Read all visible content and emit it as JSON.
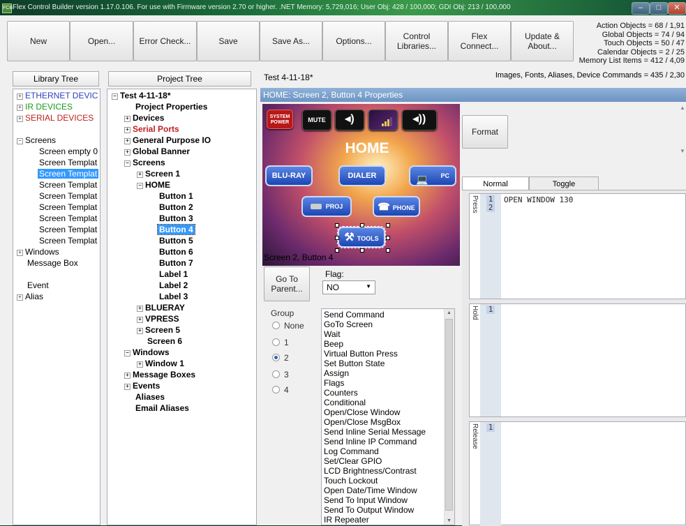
{
  "window": {
    "title": "Flex Control Builder version 1.17.0.106. For use with Firmware version 2.70 or higher.   .NET Memory: 5,729,016; User Obj: 428 / 100,000; GDI Obj: 213 / 100,000",
    "app_icon": "FCB",
    "minimize": "–",
    "maximize": "□",
    "close": "✕"
  },
  "toolbar": {
    "new": "New",
    "open": "Open...",
    "error_check": "Error Check...",
    "save": "Save",
    "save_as": "Save As...",
    "options": "Options...",
    "control_libraries": "Control Libraries...",
    "flex_connect": "Flex Connect...",
    "update_about": "Update & About..."
  },
  "stats": {
    "action_objects": "Action Objects = 68 / 1,91",
    "global_objects": "Global Objects = 74 / 94",
    "touch_objects": "Touch Objects = 50 / 47",
    "calendar_objects": "Calendar Objects = 2 / 25",
    "memory_list": "Memory List Items = 412 / 4,09",
    "images_fonts": "Images, Fonts, Aliases,  Device Commands = 435 / 2,30"
  },
  "library_tree": {
    "header": "Library Tree",
    "items": {
      "ethernet": "ETHERNET DEVIC",
      "ir": "IR DEVICES",
      "serial": "SERIAL DEVICES",
      "screens": "Screens",
      "s0": "Screen empty 0",
      "s1": "Screen Templat",
      "s2": "Screen Templat",
      "s3": "Screen Templat",
      "s4": "Screen Templat",
      "s5": "Screen Templat",
      "s6": "Screen Templat",
      "s7": "Screen Templat",
      "s8": "Screen Templat",
      "windows": "Windows",
      "message_box": "Message Box",
      "event": "Event",
      "alias": "Alias"
    },
    "colors": {
      "ethernet": "#2f3fbf",
      "ir": "#1a9a1a",
      "serial": "#c02020"
    }
  },
  "project_tree": {
    "header": "Project Tree",
    "root": "Test 4-11-18*",
    "project_properties": "Project Properties",
    "devices": "Devices",
    "serial_ports": "Serial Ports",
    "gpio": "General Purpose IO",
    "global_banner": "Global Banner",
    "screens": "Screens",
    "screen1": "Screen 1",
    "home": "HOME",
    "b1": "Button 1",
    "b2": "Button 2",
    "b3": "Button 3",
    "b4": "Button 4",
    "b5": "Button 5",
    "b6": "Button 6",
    "b7": "Button 7",
    "l1": "Label 1",
    "l2": "Label 2",
    "l3": "Label 3",
    "blueray": "BLUERAY",
    "vpress": "VPRESS",
    "screen5": "Screen 5",
    "screen6": "Screen 6",
    "windows": "Windows",
    "window1": "Window 1",
    "message_boxes": "Message Boxes",
    "events": "Events",
    "aliases": "Aliases",
    "email_aliases": "Email Aliases"
  },
  "properties": {
    "file_label": "Test 4-11-18*",
    "header": "HOME: Screen 2, Button 4 Properties",
    "caption": "Screen 2, Button 4",
    "format": "Format",
    "go_to_parent": "Go To Parent...",
    "flag_label": "Flag:",
    "flag_value": "NO",
    "group_label": "Group",
    "group_options": [
      "None",
      "1",
      "2",
      "3",
      "4"
    ],
    "group_selected": "2"
  },
  "preview": {
    "system_power": "SYSTEM POWER",
    "mute": "MUTE",
    "home": "HOME",
    "bluray": "BLU-RAY",
    "dialer": "DIALER",
    "pc": "PC",
    "proj": "PROJ",
    "phone": "PHONE",
    "tools": "TOOLS"
  },
  "commands": [
    "Send Command",
    "GoTo Screen",
    "Wait",
    "Beep",
    "Virtual Button Press",
    "Set Button State",
    "Assign",
    "Flags",
    "Counters",
    "Conditional",
    "Open/Close Window",
    "Open/Close MsgBox",
    "Send Inline Serial Message",
    "Send Inline IP Command",
    "Log Command",
    "Set/Clear GPIO",
    "LCD Brightness/Contrast",
    "Touch Lockout",
    "Open Date/Time Window",
    "Send To Input Window",
    "Send To Output Window",
    "IR Repeater"
  ],
  "tabs": {
    "normal": "Normal",
    "toggle": "Toggle"
  },
  "segments": {
    "press": "Press",
    "hold": "Hold",
    "release": "Release",
    "press_lines": [
      "1",
      "2"
    ],
    "press_code": "OPEN WINDOW 130",
    "hold_lines": [
      "1"
    ],
    "release_lines": [
      "1"
    ]
  }
}
